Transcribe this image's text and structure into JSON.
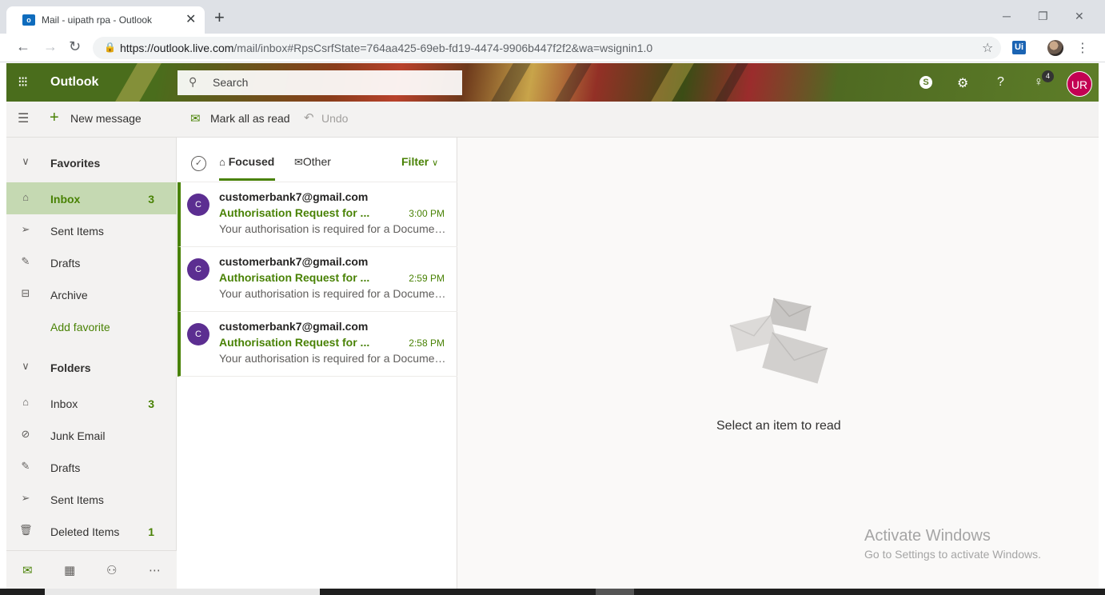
{
  "browser": {
    "tab_title": "Mail - uipath rpa - Outlook",
    "tab_close": "✕",
    "new_tab": "+",
    "url_host": "https://outlook.live.com",
    "url_path": "/mail/inbox#RpsCsrfState=764aa425-69eb-fd19-4474-9906b447f2f2&wa=wsignin1.0",
    "ext_label": "Ui"
  },
  "header": {
    "brand": "Outlook",
    "search_placeholder": "Search",
    "skype": "S",
    "notification_count": "4",
    "avatar_initials": "UR",
    "help": "?"
  },
  "commands": {
    "new_message": "New message",
    "mark_all_read": "Mark all as read",
    "undo": "Undo"
  },
  "nav": {
    "favorites_header": "Favorites",
    "favorites": [
      {
        "label": "Inbox",
        "count": "3"
      },
      {
        "label": "Sent Items",
        "count": ""
      },
      {
        "label": "Drafts",
        "count": ""
      },
      {
        "label": "Archive",
        "count": ""
      }
    ],
    "add_favorite": "Add favorite",
    "folders_header": "Folders",
    "folders": [
      {
        "label": "Inbox",
        "count": "3"
      },
      {
        "label": "Junk Email",
        "count": ""
      },
      {
        "label": "Drafts",
        "count": ""
      },
      {
        "label": "Sent Items",
        "count": ""
      },
      {
        "label": "Deleted Items",
        "count": "1"
      }
    ]
  },
  "list": {
    "tab_focused": "Focused",
    "tab_other": "Other",
    "filter": "Filter",
    "messages": [
      {
        "avatar": "C",
        "from": "customerbank7@gmail.com",
        "subject": "Authorisation Request for ...",
        "time": "3:00 PM",
        "preview": "Your authorisation is required for a Document..."
      },
      {
        "avatar": "C",
        "from": "customerbank7@gmail.com",
        "subject": "Authorisation Request for ...",
        "time": "2:59 PM",
        "preview": "Your authorisation is required for a Document..."
      },
      {
        "avatar": "C",
        "from": "customerbank7@gmail.com",
        "subject": "Authorisation Request for ...",
        "time": "2:58 PM",
        "preview": "Your authorisation is required for a Document..."
      }
    ]
  },
  "reading": {
    "empty_text": "Select an item to read"
  },
  "watermark": {
    "title": "Activate Windows",
    "subtitle": "Go to Settings to activate Windows."
  },
  "colors": {
    "accent": "#498205",
    "selected_bg": "#c5d9b2",
    "avatar_purple": "#5c2e91",
    "user_avatar": "#c30052"
  }
}
